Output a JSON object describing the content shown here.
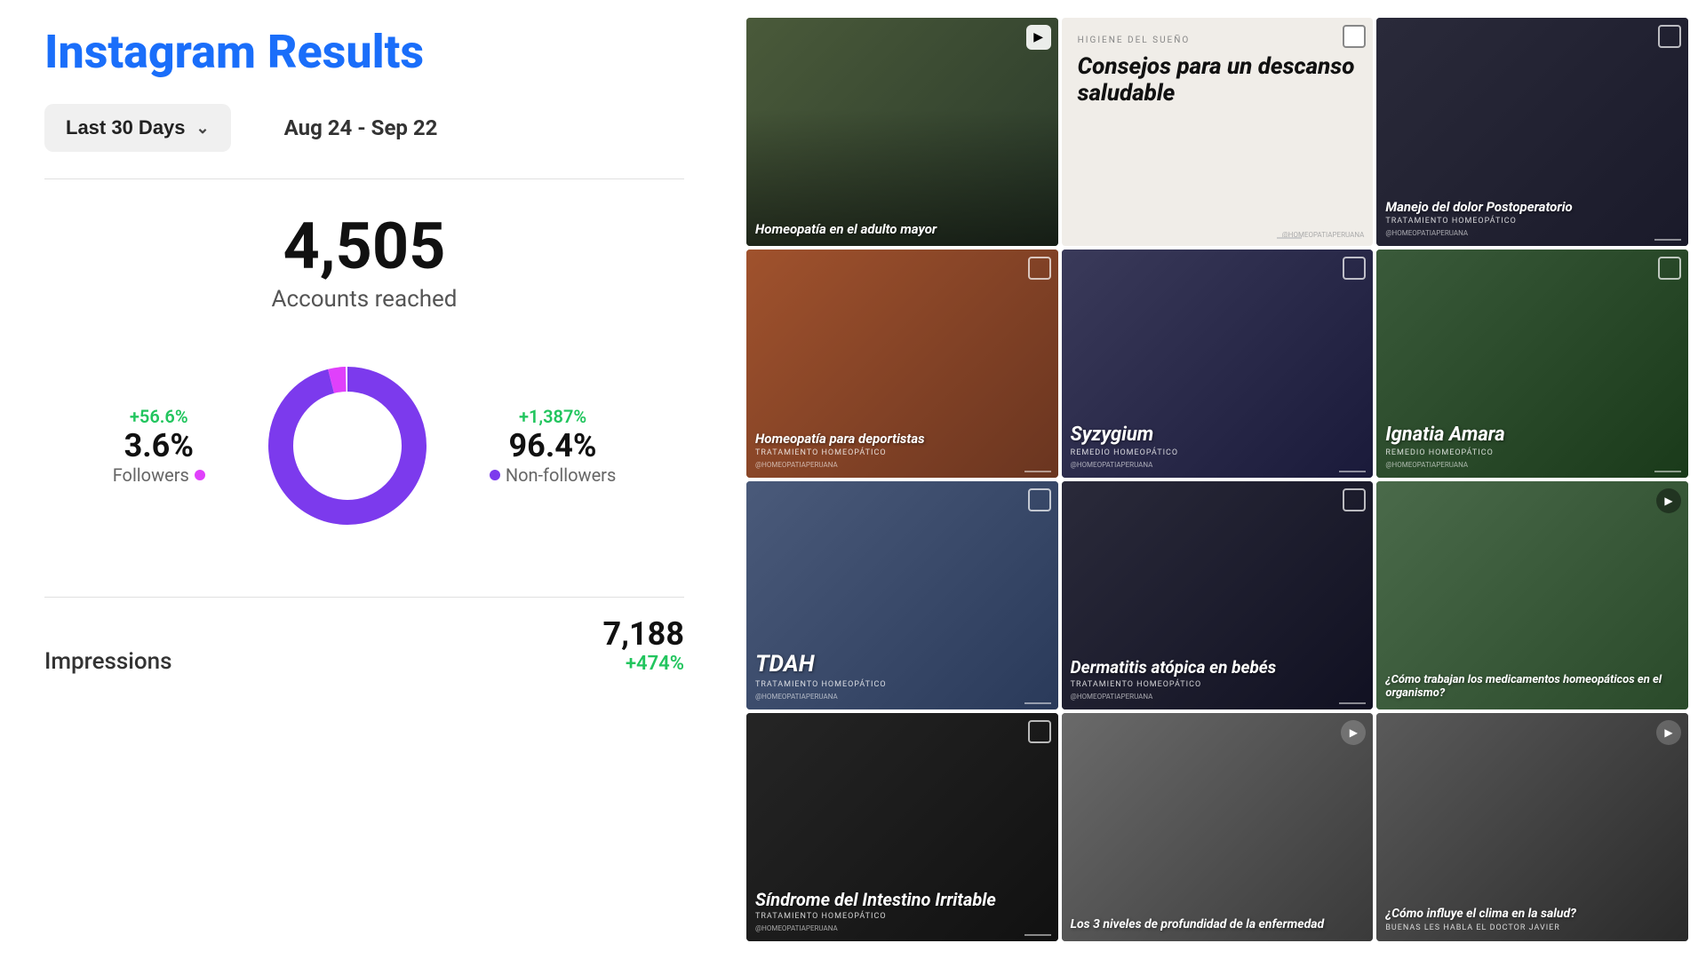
{
  "header": {
    "title": "Instagram Results"
  },
  "dateFilter": {
    "label": "Last 30 Days",
    "dateRange": "Aug 24 - Sep 22"
  },
  "accountsReached": {
    "number": "4,505",
    "label": "Accounts reached"
  },
  "followers": {
    "change": "+56.6%",
    "percentage": "3.6%",
    "label": "Followers"
  },
  "nonFollowers": {
    "change": "+1,387%",
    "percentage": "96.4%",
    "label": "Non-followers"
  },
  "impressions": {
    "label": "Impressions",
    "number": "7,188",
    "change": "+474%"
  },
  "posts": [
    {
      "id": 1,
      "title": "Homeopatía en el adulto mayor",
      "subtitle": "",
      "type": "image",
      "colorClass": "post-1"
    },
    {
      "id": 2,
      "tagline": "HIGIENE DEL SUEÑO",
      "title": "Consejos para un descanso saludable",
      "type": "text",
      "colorClass": "post-2"
    },
    {
      "id": 3,
      "title": "Manejo del dolor Postoperatorio",
      "subtitle": "TRATAMIENTO HOMEOPÁTICO",
      "type": "image",
      "colorClass": "post-3"
    },
    {
      "id": 4,
      "title": "Homeopatía para deportistas",
      "subtitle": "TRATAMIENTO HOMEOPÁTICO",
      "type": "image",
      "colorClass": "post-4"
    },
    {
      "id": 5,
      "title": "Syzygium",
      "subtitle": "REMEDIO HOMEOPÁTICO",
      "type": "image",
      "colorClass": "post-5"
    },
    {
      "id": 6,
      "title": "Ignatia Amara",
      "subtitle": "REMEDIO HOMEOPÁTICO",
      "type": "image",
      "colorClass": "post-6"
    },
    {
      "id": 7,
      "title": "TDAH",
      "subtitle": "TRATAMIENTO HOMEOPÁTICO",
      "type": "image",
      "colorClass": "post-7"
    },
    {
      "id": 8,
      "title": "Dermatitis atópica en bebés",
      "subtitle": "TRATAMIENTO HOMEOPÁTICO",
      "type": "image",
      "colorClass": "post-8"
    },
    {
      "id": 9,
      "title": "¿Cómo trabajan los medicamentos homeopáticos en el organismo?",
      "subtitle": "",
      "type": "video",
      "colorClass": "post-9"
    },
    {
      "id": 10,
      "title": "Síndrome del Intestino Irritable",
      "subtitle": "TRATAMIENTO HOMEOPÁTICO",
      "type": "image",
      "colorClass": "post-10"
    },
    {
      "id": 11,
      "title": "Los 3 niveles de profundidad de la enfermedad",
      "subtitle": "",
      "type": "video",
      "colorClass": "post-11"
    },
    {
      "id": 12,
      "title": "¿Cómo influye el clima en la salud?",
      "subtitle": "buenas les habla el doctor Javier",
      "type": "video",
      "colorClass": "post-12"
    }
  ]
}
